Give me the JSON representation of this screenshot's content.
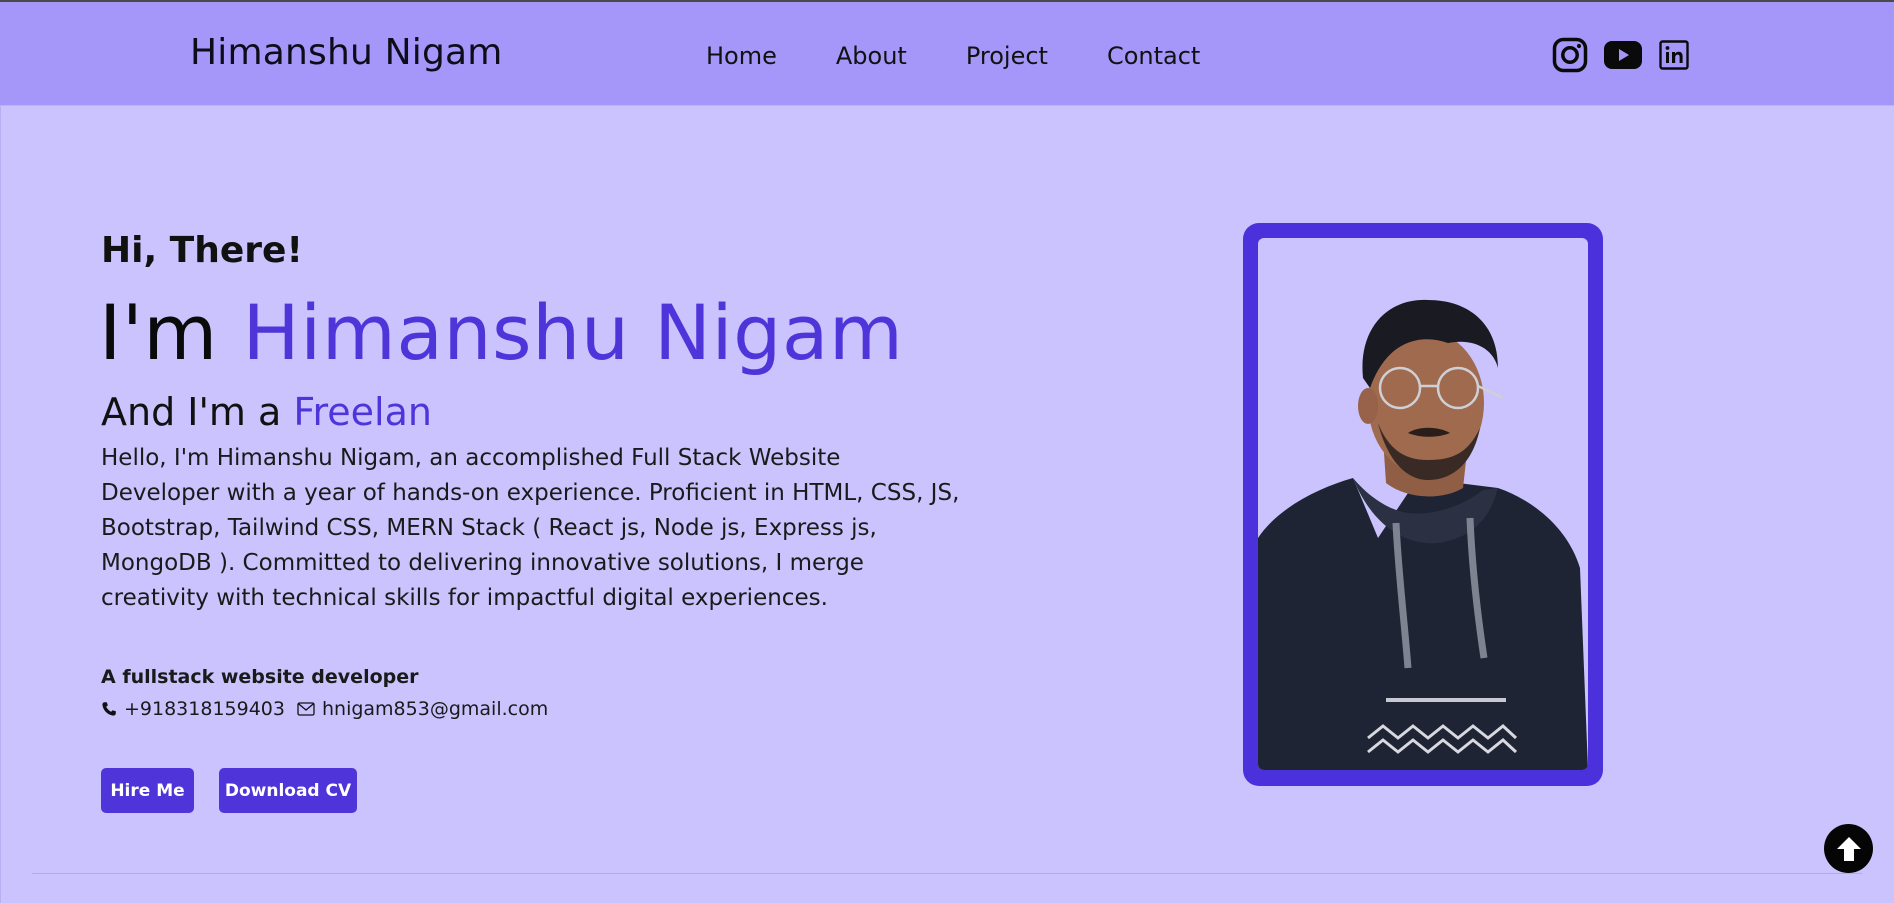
{
  "header": {
    "brand": "Himanshu Nigam",
    "nav": [
      "Home",
      "About",
      "Project",
      "Contact"
    ],
    "social_icons": [
      "instagram-icon",
      "youtube-icon",
      "linkedin-icon"
    ]
  },
  "hero": {
    "greeting": "Hi, There!",
    "title_prefix": "I'm",
    "title_name": "Himanshu Nigam",
    "role_prefix": "And I'm a",
    "role_typed": "Freelan",
    "bio": "Hello, I'm Himanshu Nigam, an accomplished Full Stack Website Developer with a year of hands-on experience. Proficient in HTML, CSS, JS, Bootstrap, Tailwind CSS, MERN Stack ( React js, Node js, Express js, MongoDB ). Committed to delivering innovative solutions, I merge creativity with technical skills for impactful digital experiences.",
    "tagline": "A fullstack website developer",
    "phone": "+918318159403",
    "email": "hnigam853@gmail.com",
    "buttons": {
      "hire": "Hire Me",
      "cv": "Download CV"
    }
  },
  "colors": {
    "navbar_bg": "#a497f9",
    "page_bg": "#cbc3fe",
    "accent": "#4f35d9"
  },
  "icons": {
    "phone": "phone-icon",
    "email": "mail-icon",
    "scroll_top": "arrow-up-circle-icon"
  }
}
